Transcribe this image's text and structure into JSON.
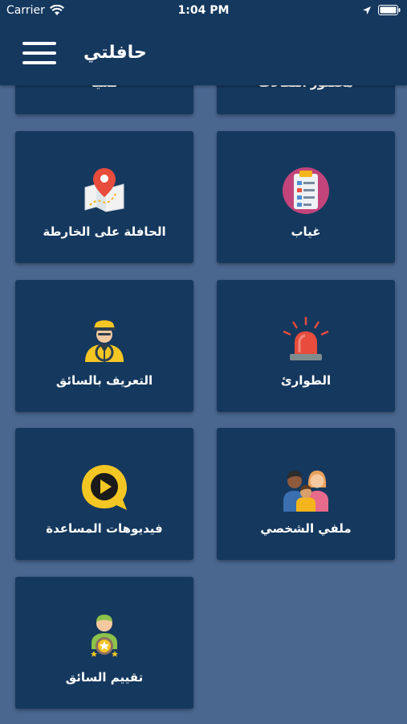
{
  "status_bar": {
    "carrier": "Carrier",
    "time": "1:04 PM"
  },
  "nav": {
    "title": "حافلتي"
  },
  "tiles": [
    {
      "label": "نسيا",
      "icon": "partial-icon"
    },
    {
      "label": "محضور انتقالات",
      "icon": "partial-icon"
    },
    {
      "label": "الحافلة على الخارطة",
      "icon": "map-pin-icon"
    },
    {
      "label": "غياب",
      "icon": "clipboard-checklist-icon"
    },
    {
      "label": "التعريف بالسائق",
      "icon": "driver-icon"
    },
    {
      "label": "الطوارئ",
      "icon": "siren-icon"
    },
    {
      "label": "فيديوهات المساعدة",
      "icon": "play-video-icon"
    },
    {
      "label": "ملفي الشخصي",
      "icon": "family-icon"
    },
    {
      "label": "تقييم السائق",
      "icon": "driver-rating-icon"
    }
  ],
  "colors": {
    "background": "#4a6790",
    "tile": "#15385e",
    "bar": "#15385e",
    "text": "#ffffff"
  }
}
